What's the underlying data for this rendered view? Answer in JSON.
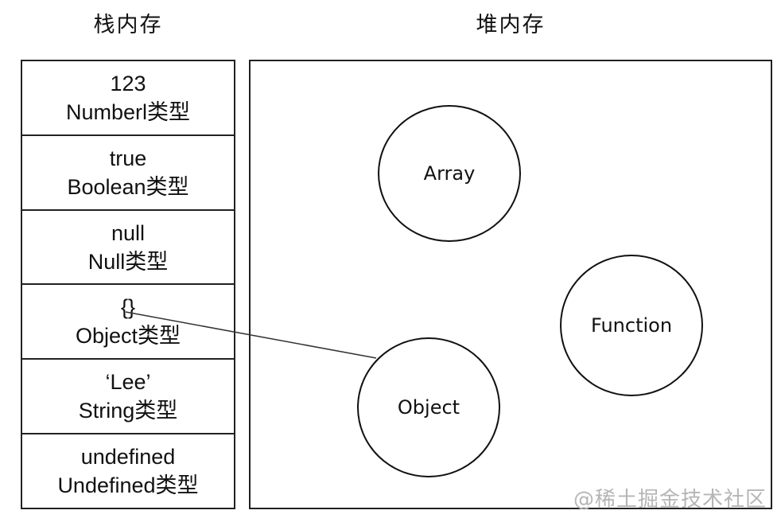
{
  "titles": {
    "stack": "栈内存",
    "heap": "堆内存"
  },
  "stack_cells": [
    {
      "value": "123",
      "type": "Numberl类型"
    },
    {
      "value": "true",
      "type": "Boolean类型"
    },
    {
      "value": "null",
      "type": "Null类型"
    },
    {
      "value": "{}",
      "type": "Object类型"
    },
    {
      "value": "‘Lee’",
      "type": "String类型"
    },
    {
      "value": "undefined",
      "type": "Undefined类型"
    }
  ],
  "heap_nodes": {
    "array": "Array",
    "function": "Function",
    "object": "Object"
  },
  "watermark": "@稀土掘金技术社区"
}
